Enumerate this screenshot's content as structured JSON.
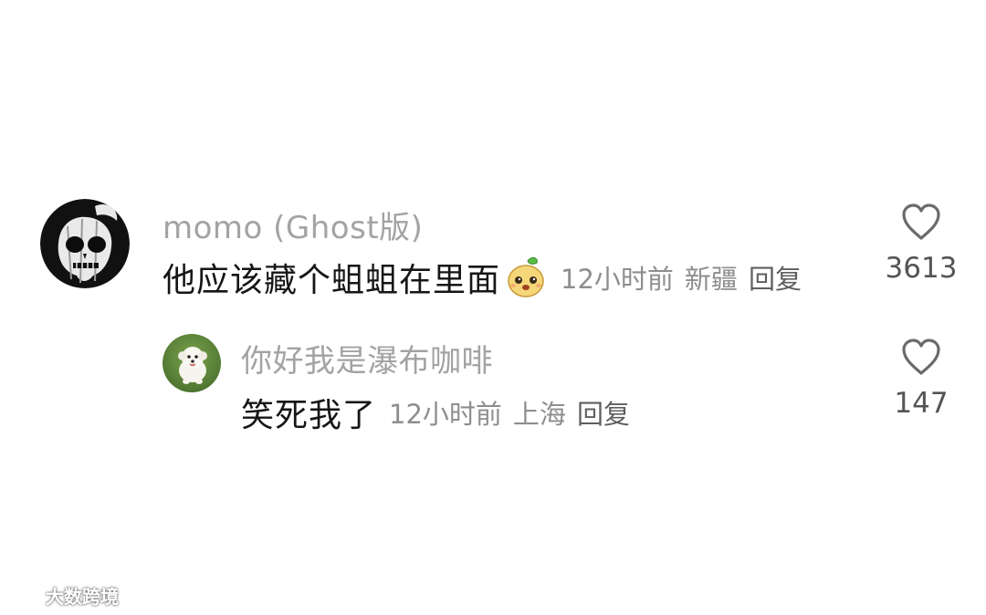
{
  "comments": [
    {
      "username": "momo (Ghost版)",
      "text": "他应该藏个蛆蛆在里面",
      "emoji": "pear-face-emoji",
      "time": "12小时前",
      "location": "新疆",
      "reply_label": "回复",
      "likes": "3613"
    },
    {
      "username": "你好我是瀑布咖啡",
      "text": "笑死我了",
      "time": "12小时前",
      "location": "上海",
      "reply_label": "回复",
      "likes": "147"
    }
  ],
  "watermark": {
    "text": "大数跨境"
  },
  "colors": {
    "username": "#a3a3a3",
    "content": "#161616",
    "meta": "#8e8e8e",
    "icon": "#6b6b6b"
  },
  "icons": {
    "like": "heart-outline-icon",
    "avatar1": "skull-avatar",
    "avatar2": "white-dog-avatar"
  }
}
